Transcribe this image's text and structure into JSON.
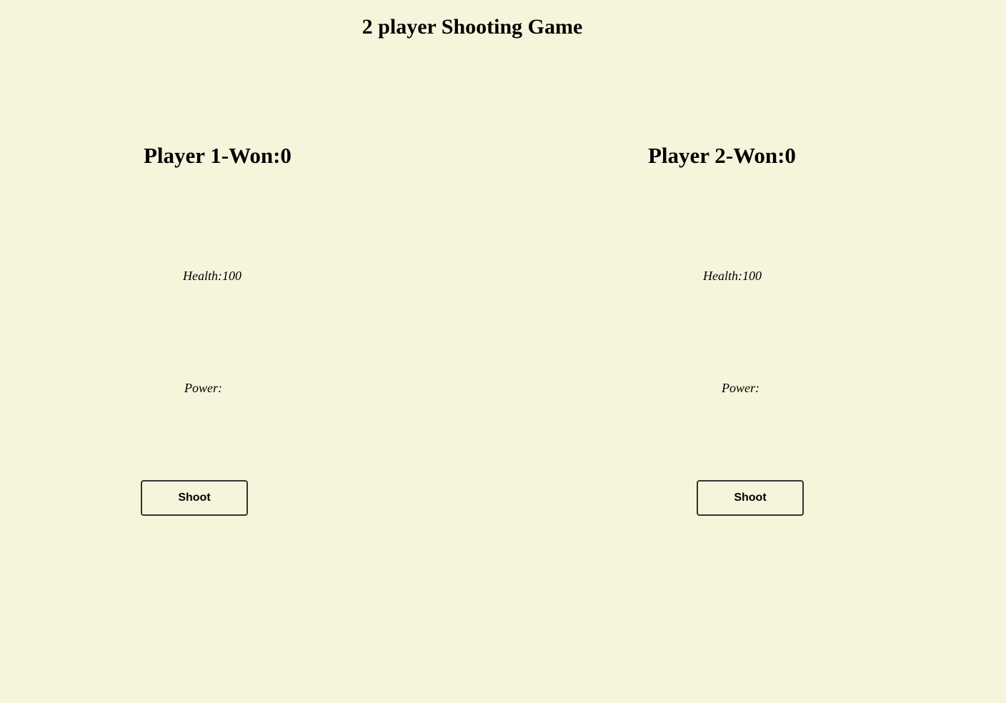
{
  "title": "2 player Shooting Game",
  "players": [
    {
      "heading": "Player 1-Won:0",
      "health": "Health:100",
      "power": "Power:",
      "shoot_label": "Shoot"
    },
    {
      "heading": "Player 2-Won:0",
      "health": "Health:100",
      "power": "Power:",
      "shoot_label": "Shoot"
    }
  ],
  "colors": {
    "background": "#f5f5dc",
    "text": "#000000",
    "button_border": "#333333"
  }
}
